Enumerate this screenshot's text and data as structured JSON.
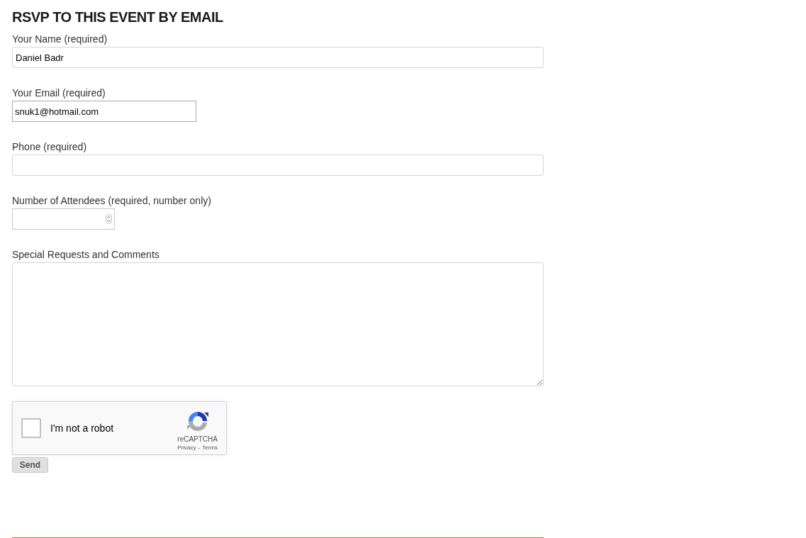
{
  "heading": "RSVP TO THIS EVENT BY EMAIL",
  "fields": [
    {
      "kind": "wide",
      "label": "Your Name (required)",
      "value": "Daniel Badr"
    },
    {
      "kind": "narrow",
      "label": "Your Email (required)",
      "value": "snuk1@hotmail.com"
    },
    {
      "kind": "wide",
      "label": "Phone (required)"
    },
    {
      "kind": "number",
      "label": "Number of Attendees (required, number only)"
    },
    {
      "kind": "textarea",
      "label": "Special Requests and Comments"
    }
  ],
  "captcha": {
    "label": "I'm not a robot",
    "checked": false,
    "brand": "reCAPTCHA",
    "privacy": "Privacy",
    "separator": "-",
    "terms": "Terms"
  },
  "submit": "Send"
}
